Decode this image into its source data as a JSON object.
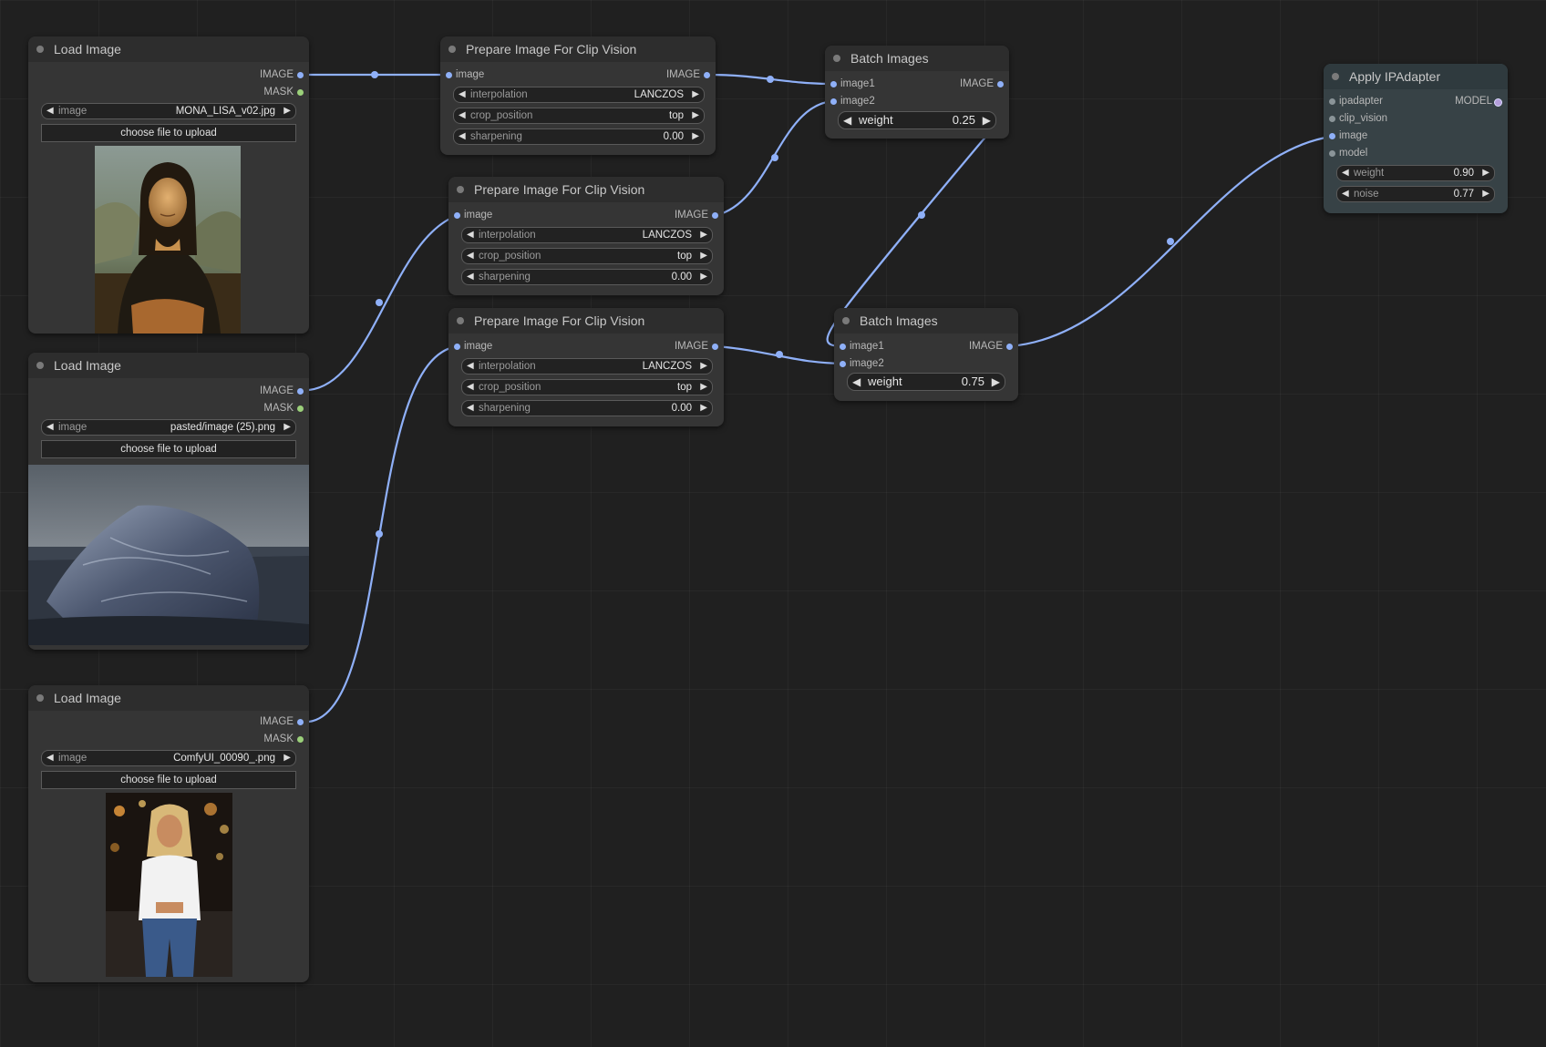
{
  "nodes": {
    "load1": {
      "title": "Load Image",
      "out1": "IMAGE",
      "out2": "MASK",
      "widget_label": "image",
      "widget_value": "MONA_LISA_v02.jpg",
      "upload": "choose file to upload"
    },
    "load2": {
      "title": "Load Image",
      "out1": "IMAGE",
      "out2": "MASK",
      "widget_label": "image",
      "widget_value": "pasted/image (25).png",
      "upload": "choose file to upload"
    },
    "load3": {
      "title": "Load Image",
      "out1": "IMAGE",
      "out2": "MASK",
      "widget_label": "image",
      "widget_value": "ComfyUI_00090_.png",
      "upload": "choose file to upload"
    },
    "prep1": {
      "title": "Prepare Image For Clip Vision",
      "in1": "image",
      "out1": "IMAGE",
      "w1_label": "interpolation",
      "w1_value": "LANCZOS",
      "w2_label": "crop_position",
      "w2_value": "top",
      "w3_label": "sharpening",
      "w3_value": "0.00"
    },
    "prep2": {
      "title": "Prepare Image For Clip Vision",
      "in1": "image",
      "out1": "IMAGE",
      "w1_label": "interpolation",
      "w1_value": "LANCZOS",
      "w2_label": "crop_position",
      "w2_value": "top",
      "w3_label": "sharpening",
      "w3_value": "0.00"
    },
    "prep3": {
      "title": "Prepare Image For Clip Vision",
      "in1": "image",
      "out1": "IMAGE",
      "w1_label": "interpolation",
      "w1_value": "LANCZOS",
      "w2_label": "crop_position",
      "w2_value": "top",
      "w3_label": "sharpening",
      "w3_value": "0.00"
    },
    "batch1": {
      "title": "Batch Images",
      "in1": "image1",
      "in2": "image2",
      "out1": "IMAGE",
      "w_label": "weight",
      "w_value": "0.25"
    },
    "batch2": {
      "title": "Batch Images",
      "in1": "image1",
      "in2": "image2",
      "out1": "IMAGE",
      "w_label": "weight",
      "w_value": "0.75"
    },
    "ipa": {
      "title": "Apply IPAdapter",
      "in1": "ipadapter",
      "in2": "clip_vision",
      "in3": "image",
      "in4": "model",
      "out1": "MODEL",
      "w1_label": "weight",
      "w1_value": "0.90",
      "w2_label": "noise",
      "w2_value": "0.77"
    }
  },
  "colors": {
    "canvas": "#202020",
    "node": "#353535",
    "node_title": "#2d2d2d",
    "link": "#8fb0f8",
    "mask_slot": "#9bd07a",
    "ipadapter_node": "#374246"
  },
  "icons": {
    "collapse": "node-collapse-dot",
    "left": "arrow-left-icon",
    "right": "arrow-right-icon"
  }
}
